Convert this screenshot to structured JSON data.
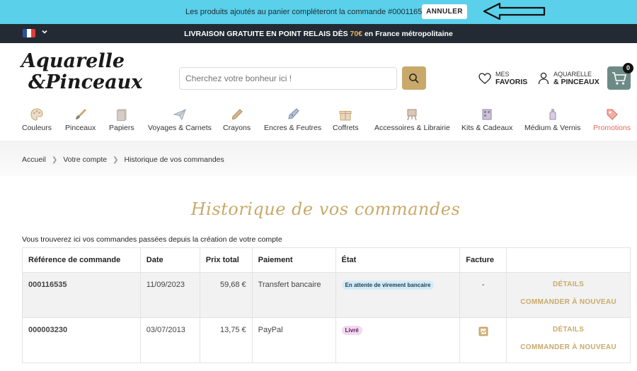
{
  "notice": {
    "text": "Les produits ajoutés au panier compléteront la commande #000116535.",
    "cancel_label": "ANNULER"
  },
  "shipping": {
    "text_before": "LIVRAISON GRATUITE EN POINT RELAIS DÈS ",
    "amount": "70€",
    "text_after": " en France métropolitaine"
  },
  "header": {
    "logo_line1": "Aquarelle",
    "logo_line2": "&Pinceaux",
    "search_placeholder": "Cherchez votre bonheur ici !",
    "favorites_line1": "MES",
    "favorites_line2": "FAVORIS",
    "account_line1": "AQUARELLE",
    "account_line2": "& PINCEAUX",
    "cart_count": "0"
  },
  "nav": {
    "items": [
      {
        "label": "Couleurs",
        "icon": "palette-icon"
      },
      {
        "label": "Pinceaux",
        "icon": "brush-icon"
      },
      {
        "label": "Papiers",
        "icon": "paper-icon"
      },
      {
        "label": "Voyages & Carnets",
        "icon": "paper-plane-icon"
      },
      {
        "label": "Crayons",
        "icon": "pencil-icon"
      },
      {
        "label": "Encres & Feutres",
        "icon": "pen-nib-icon"
      },
      {
        "label": "Coffrets",
        "icon": "gift-icon"
      },
      {
        "label": "Accessoires & Librairie",
        "icon": "easel-icon"
      },
      {
        "label": "Kits & Cadeaux",
        "icon": "kit-icon"
      },
      {
        "label": "Médium & Vernis",
        "icon": "bottle-icon"
      },
      {
        "label": "Promotions",
        "icon": "tag-icon"
      }
    ]
  },
  "breadcrumb": [
    "Accueil",
    "Votre compte",
    "Historique de vos commandes"
  ],
  "page": {
    "title": "Historique de vos commandes",
    "intro": "Vous trouverez ici vos commandes passées depuis la création de votre compte"
  },
  "orders": {
    "headers": [
      "Référence de commande",
      "Date",
      "Prix total",
      "Paiement",
      "État",
      "Facture",
      ""
    ],
    "rows": [
      {
        "ref": "000116535",
        "date": "11/09/2023",
        "total": "59,68 €",
        "payment": "Transfert bancaire",
        "status": "En attente de virement bancaire",
        "invoice": "-",
        "details": "DÉTAILS",
        "reorder": "COMMANDER À NOUVEAU"
      },
      {
        "ref": "000003230",
        "date": "03/07/2013",
        "total": "13,75 €",
        "payment": "PayPal",
        "status": "Livré",
        "invoice": "pdf-icon",
        "details": "DÉTAILS",
        "reorder": "COMMANDER À NOUVEAU"
      }
    ]
  },
  "colors": {
    "notice_bg": "#5ad0ea",
    "shipbar_bg": "#232a33",
    "accent_gold": "#c9a96a",
    "promo_red": "#e06a5c",
    "cart_bg": "#6d8a86"
  }
}
